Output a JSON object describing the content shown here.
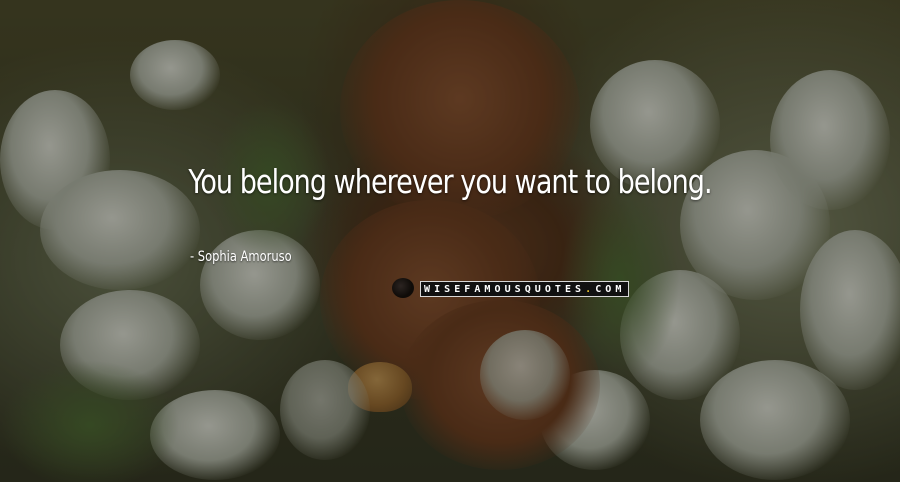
{
  "quote": {
    "text": "You belong wherever you want to belong.",
    "author": "Sophia Amoruso"
  },
  "watermark": {
    "brand": "WISEFAMOUSQUOTES",
    "dot": ".",
    "tld": "COM",
    "brand_color": "#ffffff",
    "accent_color": "#e8c230"
  },
  "background": {
    "subject": "red squirrel holding a nut among white snowdrop flowers",
    "icons": [
      "squirrel-photo"
    ]
  }
}
